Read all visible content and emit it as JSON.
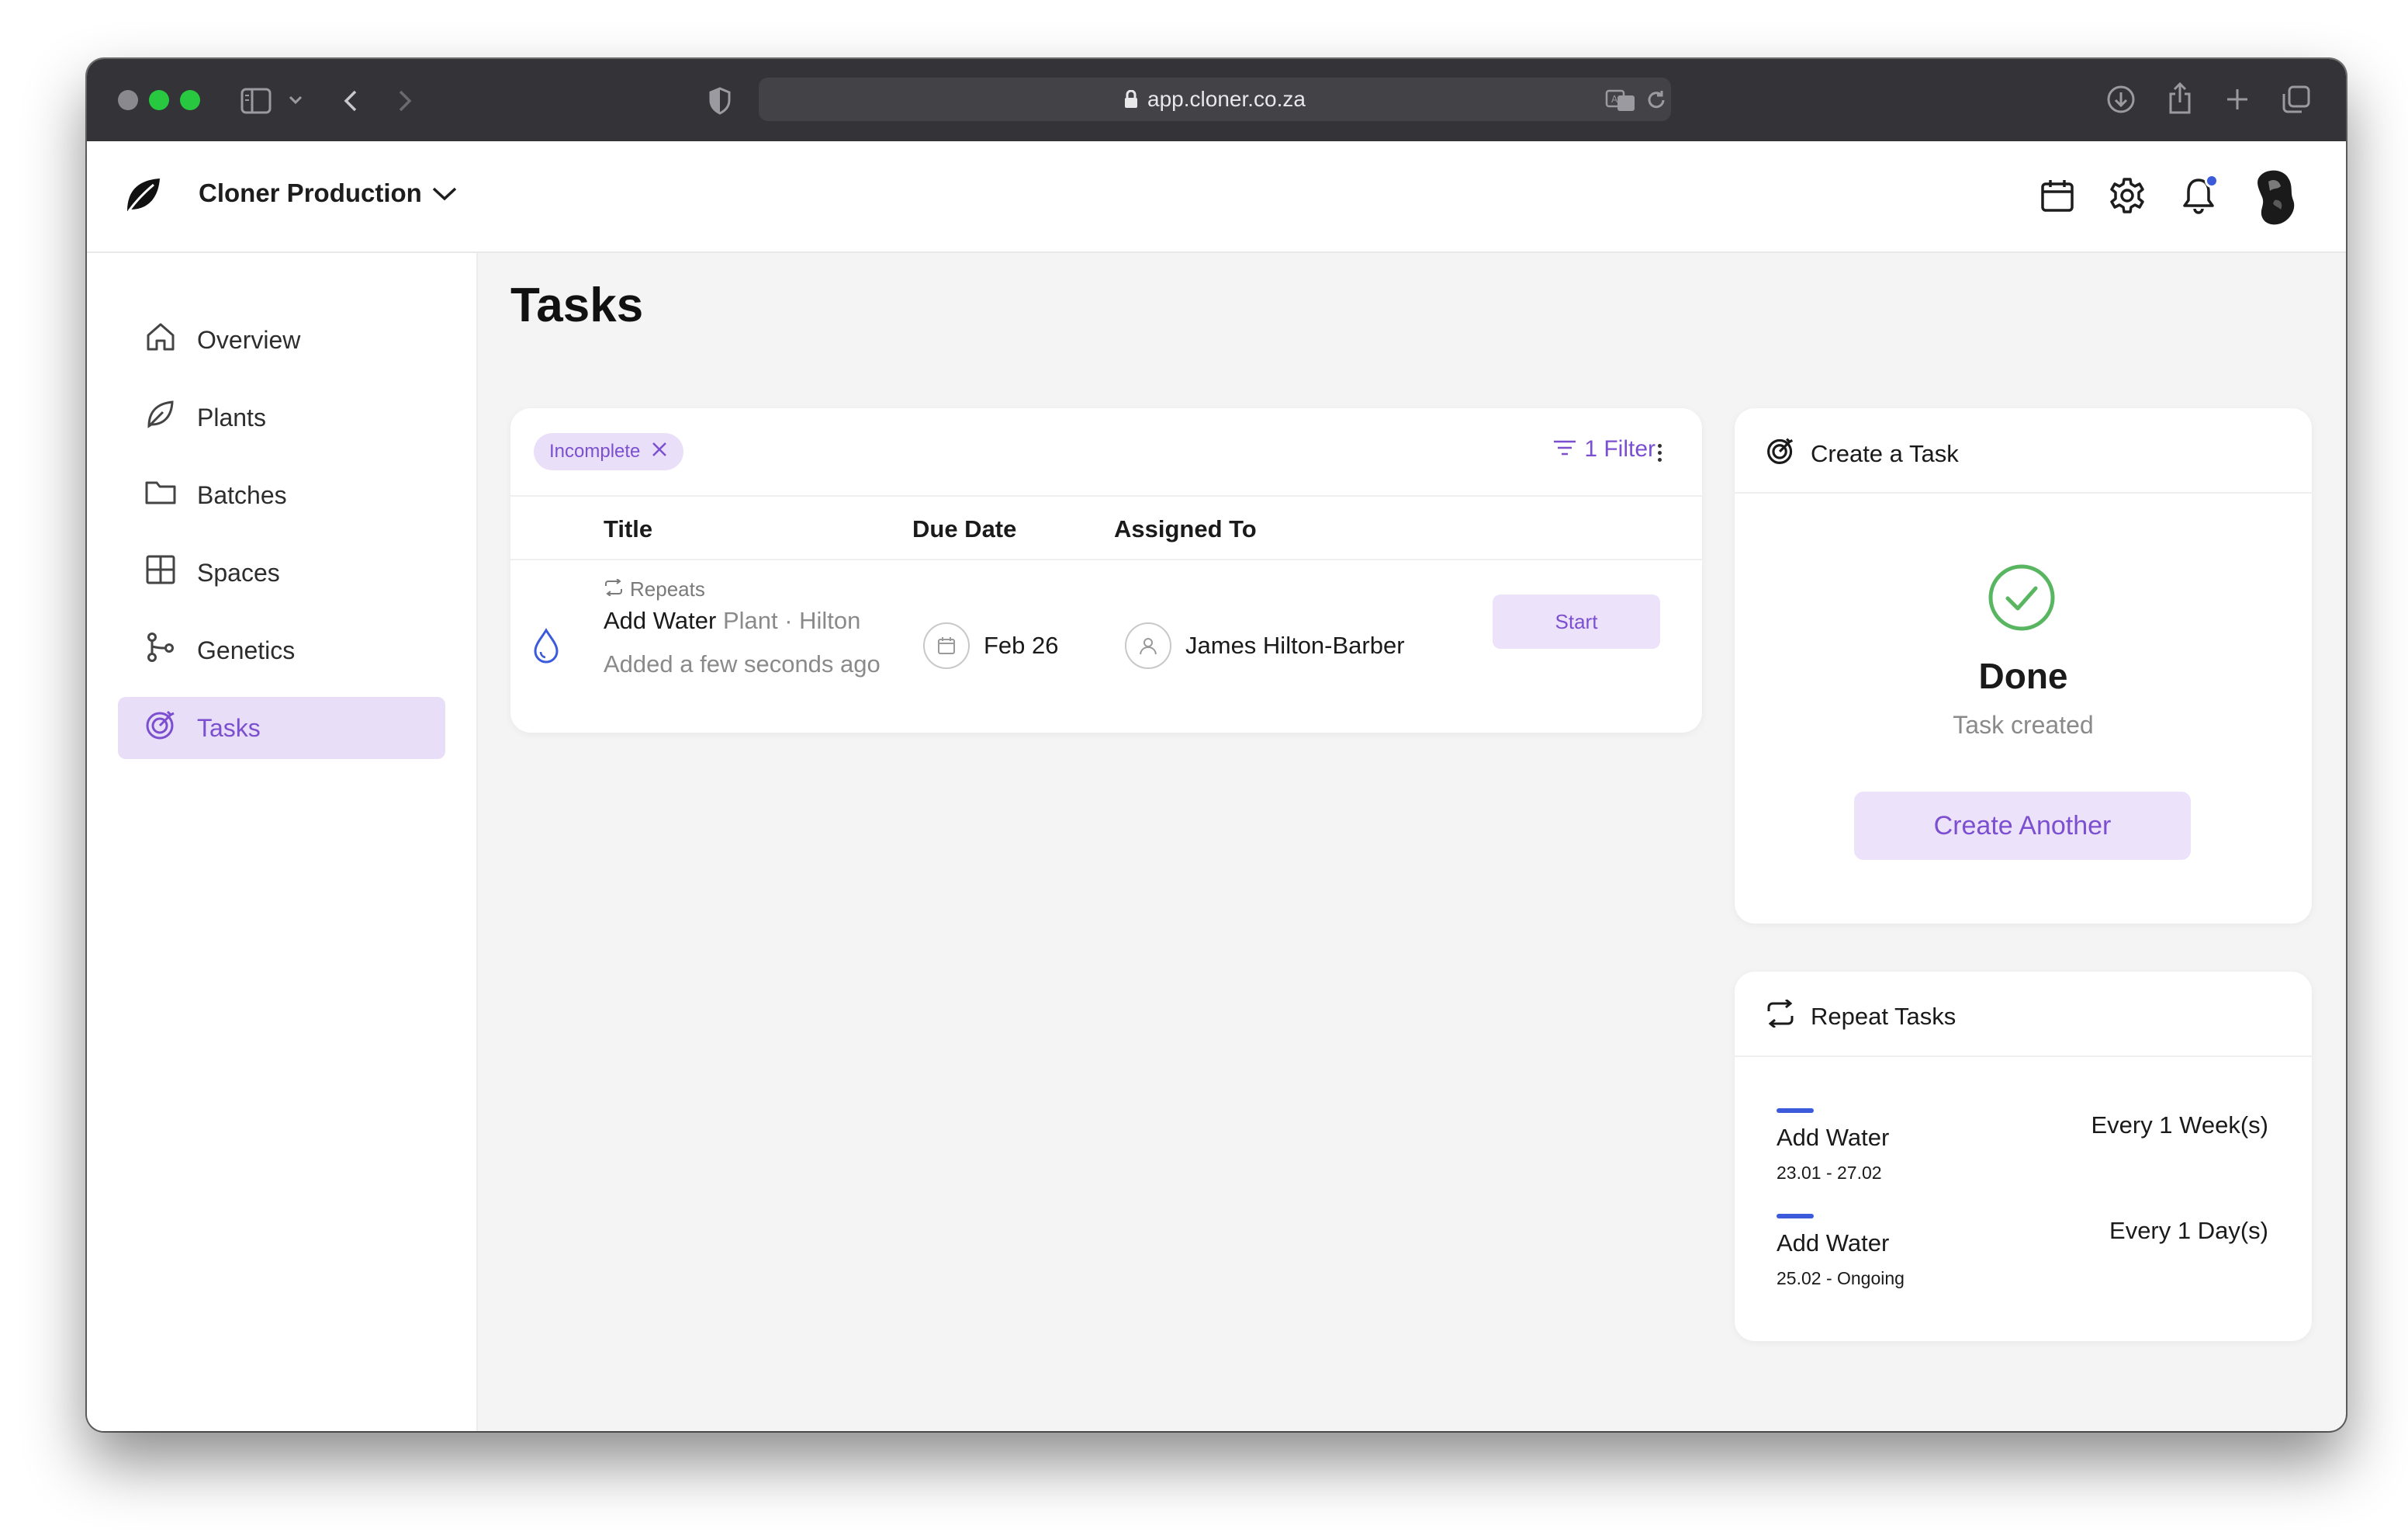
{
  "browser": {
    "url": "app.cloner.co.za",
    "traffic_colors": [
      "#ff5f57",
      "#28c840",
      "#28c840"
    ]
  },
  "header": {
    "org_name": "Cloner Production",
    "icons": [
      "calendar-icon",
      "gear-icon",
      "bell-icon"
    ],
    "notification_dot_color": "#3b5bdb"
  },
  "sidebar": {
    "items": [
      {
        "label": "Overview",
        "icon": "home-icon"
      },
      {
        "label": "Plants",
        "icon": "leaf-icon"
      },
      {
        "label": "Batches",
        "icon": "folder-icon"
      },
      {
        "label": "Spaces",
        "icon": "grid-icon"
      },
      {
        "label": "Genetics",
        "icon": "branch-icon"
      },
      {
        "label": "Tasks",
        "icon": "target-icon",
        "active": true
      }
    ]
  },
  "main": {
    "title": "Tasks",
    "filter_chip": "Incomplete",
    "filter_button": "1 Filter",
    "columns": [
      "Title",
      "Due Date",
      "Assigned To"
    ],
    "task": {
      "repeats_label": "Repeats",
      "title": "Add Water",
      "context": "Plant · Hilton",
      "added": "Added a few seconds ago",
      "due": "Feb 26",
      "assignee": "James Hilton-Barber",
      "action": "Start"
    }
  },
  "create_task": {
    "heading": "Create a Task",
    "status_title": "Done",
    "status_sub": "Task created",
    "button": "Create Another"
  },
  "repeat_tasks": {
    "heading": "Repeat Tasks",
    "items": [
      {
        "name": "Add Water",
        "range": "23.01 - 27.02",
        "frequency": "Every 1 Week(s)"
      },
      {
        "name": "Add Water",
        "range": "25.02 - Ongoing",
        "frequency": "Every 1 Day(s)"
      }
    ]
  },
  "colors": {
    "accent": "#7b4fd0",
    "accent_bg": "#e9dff8",
    "success": "#58b560",
    "indicator": "#3b5bdb"
  }
}
